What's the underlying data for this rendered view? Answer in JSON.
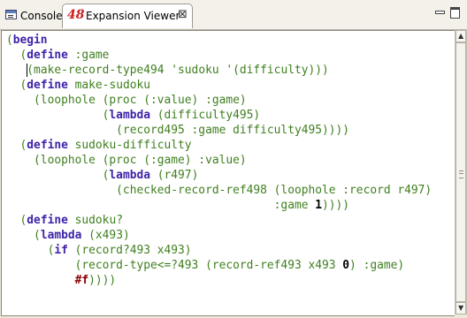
{
  "tabs": {
    "console": {
      "label": "Console",
      "icon": "console-icon"
    },
    "expansion": {
      "label": "Expansion Viewer",
      "icon": "lambda-48-icon",
      "icon_text": "48"
    }
  },
  "window_controls": {
    "minimize": "minimize-icon",
    "maximize": "maximize-icon"
  },
  "code_lines": [
    [
      [
        "paren",
        "("
      ],
      [
        "kw",
        "begin"
      ]
    ],
    [
      [
        "plain",
        "  ("
      ],
      [
        "kw",
        "define"
      ],
      [
        "plain",
        " :game"
      ]
    ],
    [
      [
        "plain",
        "   "
      ],
      [
        "caret",
        ""
      ],
      [
        "plain",
        "(make-record-type494 'sudoku '(difficulty)))"
      ]
    ],
    [
      [
        "plain",
        "  ("
      ],
      [
        "kw",
        "define"
      ],
      [
        "plain",
        " make-sudoku"
      ]
    ],
    [
      [
        "plain",
        "    (loophole (proc (:value) :game)"
      ]
    ],
    [
      [
        "plain",
        "              ("
      ],
      [
        "kw",
        "lambda"
      ],
      [
        "plain",
        " (difficulty495)"
      ]
    ],
    [
      [
        "plain",
        "                (record495 :game difficulty495))))"
      ]
    ],
    [
      [
        "plain",
        "  ("
      ],
      [
        "kw",
        "define"
      ],
      [
        "plain",
        " sudoku-difficulty"
      ]
    ],
    [
      [
        "plain",
        "    (loophole (proc (:game) :value)"
      ]
    ],
    [
      [
        "plain",
        "              ("
      ],
      [
        "kw",
        "lambda"
      ],
      [
        "plain",
        " (r497)"
      ]
    ],
    [
      [
        "plain",
        "                (checked-record-ref498 (loophole :record r497)"
      ]
    ],
    [
      [
        "plain",
        "                                       :game "
      ],
      [
        "num",
        "1"
      ],
      [
        "plain",
        "))))"
      ]
    ],
    [
      [
        "plain",
        "  ("
      ],
      [
        "kw",
        "define"
      ],
      [
        "plain",
        " sudoku?"
      ]
    ],
    [
      [
        "plain",
        "    ("
      ],
      [
        "kw",
        "lambda"
      ],
      [
        "plain",
        " (x493)"
      ]
    ],
    [
      [
        "plain",
        "      ("
      ],
      [
        "kw",
        "if"
      ],
      [
        "plain",
        " (record?493 x493)"
      ]
    ],
    [
      [
        "plain",
        "          (record-type<=?493 (record-ref493 x493 "
      ],
      [
        "num",
        "0"
      ],
      [
        "plain",
        ") :game)"
      ]
    ],
    [
      [
        "plain",
        "          "
      ],
      [
        "bool",
        "#f"
      ],
      [
        "plain",
        "))))"
      ]
    ]
  ],
  "colors": {
    "keyword": "#3f23a9",
    "code": "#3f7f1f",
    "number": "#000000",
    "boolean": "#8b0000",
    "accent_icon": "#cc2020"
  }
}
